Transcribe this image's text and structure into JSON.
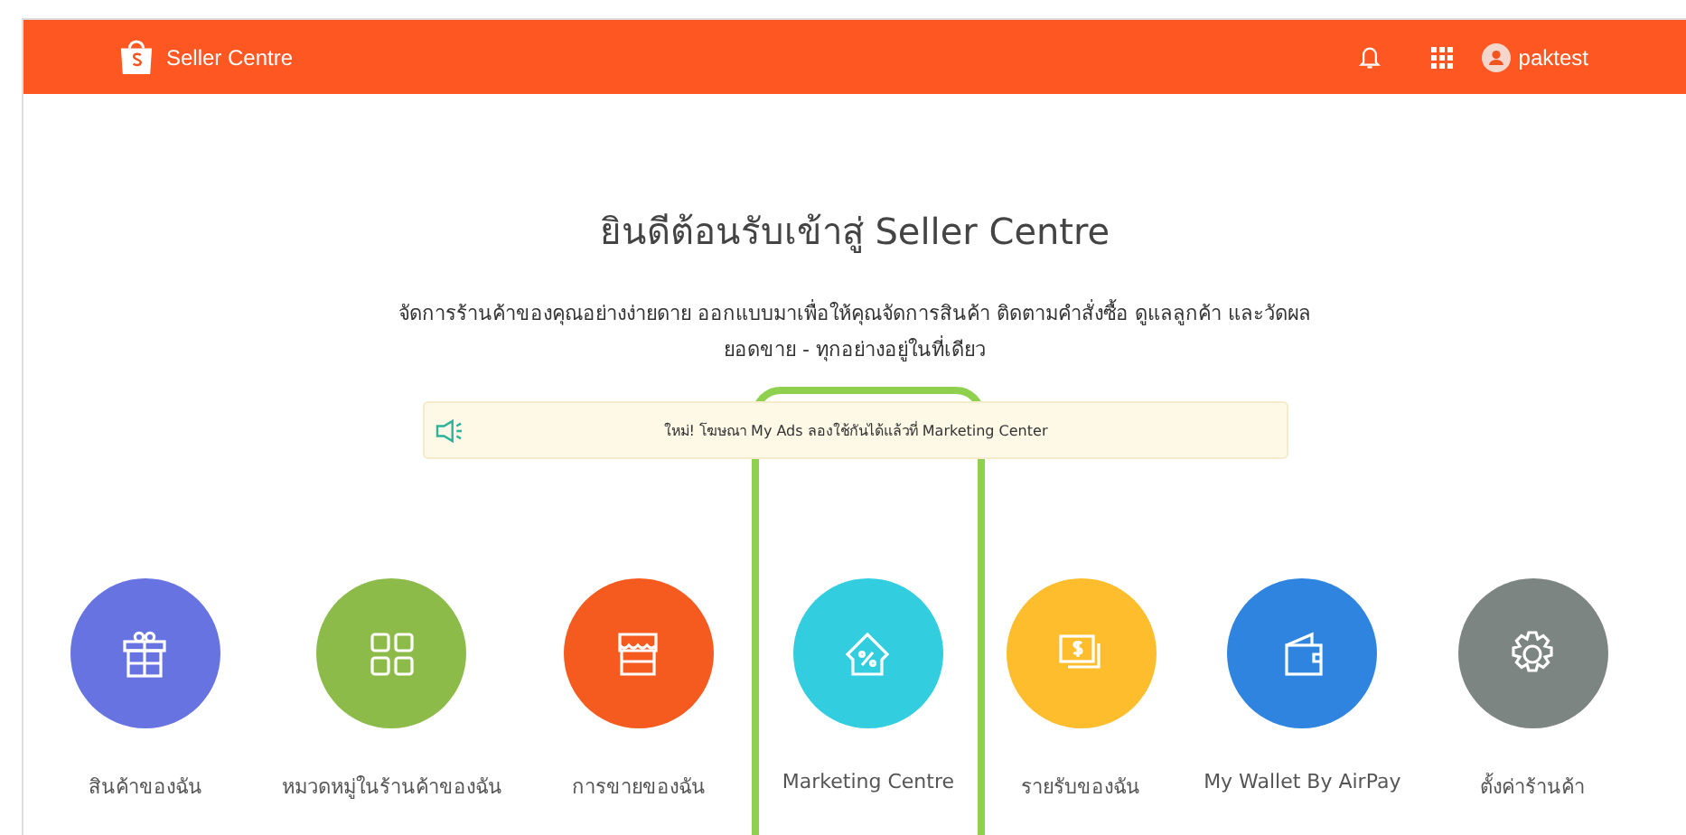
{
  "header": {
    "brand": "Seller Centre",
    "user": "paktest"
  },
  "welcome": {
    "title": "ยินดีต้อนรับเข้าสู่ Seller Centre",
    "subtitle_lines": [
      "จัดการร้านค้าของคุณอย่างง่ายดาย ออกแบบมาเพื่อให้คุณจัดการสินค้า ติดตามคำสั่งซื้อ ดูแลลูกค้า และวัดผล",
      "ยอดขาย - ทุกอย่างอยู่ในที่เดียว"
    ]
  },
  "notice": {
    "text": "ใหม่! โฆษณา My Ads ลองใช้กันได้แล้วที่ Marketing Center"
  },
  "tiles": [
    {
      "label": "สินค้าของฉัน",
      "kind": "gift",
      "color": "#6673e0",
      "highlighted": false
    },
    {
      "label": "หมวดหมู่ในร้านค้าของฉัน",
      "kind": "grid",
      "color": "#8dbb4a",
      "highlighted": false
    },
    {
      "label": "การขายของฉัน",
      "kind": "shop",
      "color": "#f55a1e",
      "highlighted": false
    },
    {
      "label": "Marketing Centre",
      "kind": "house",
      "color": "#33cde0",
      "highlighted": true
    },
    {
      "label": "รายรับของฉัน",
      "kind": "money",
      "color": "#fdbd2c",
      "highlighted": false
    },
    {
      "label": "My Wallet By AirPay",
      "kind": "wallet",
      "color": "#2f84e0",
      "highlighted": false
    },
    {
      "label": "ตั้งค่าร้านค้า",
      "kind": "gear",
      "color": "#7d8583",
      "highlighted": false
    }
  ]
}
